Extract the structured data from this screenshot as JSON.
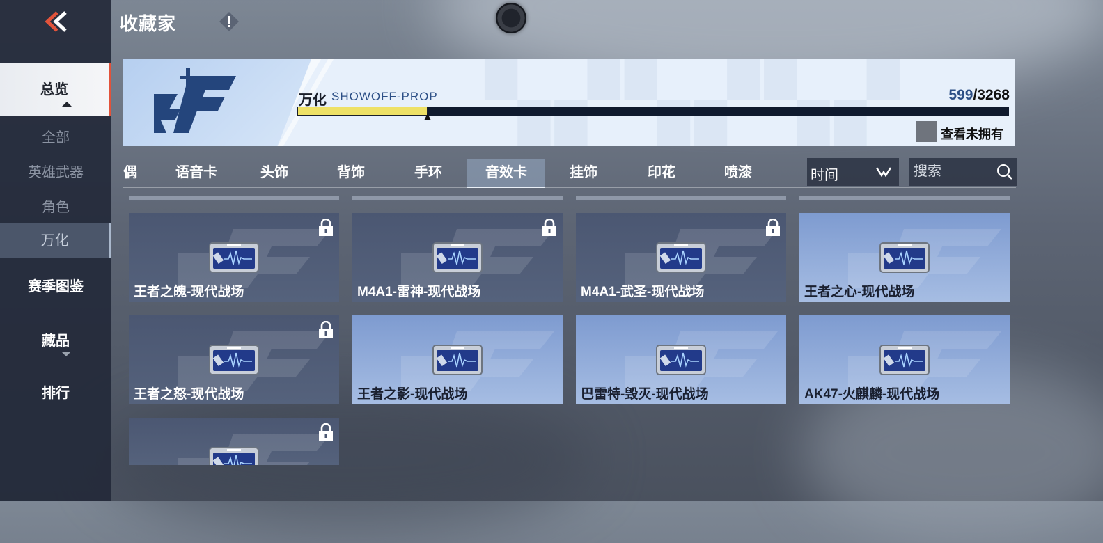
{
  "header": {
    "title": "收藏家"
  },
  "sidebar": {
    "active": "总览",
    "sub_items": [
      "全部",
      "英雄武器",
      "角色",
      "万化"
    ],
    "main_items": [
      "赛季图鉴",
      "藏品",
      "排行"
    ]
  },
  "banner": {
    "collection_name": "万化",
    "collection_tag": "SHOWOFF-PROP",
    "owned": "599",
    "total": "/3268",
    "progress": 0.183,
    "toggle_label": "查看未拥有"
  },
  "tabs": [
    "偶",
    "语音卡",
    "头饰",
    "背饰",
    "手环",
    "音效卡",
    "挂饰",
    "印花",
    "喷漆"
  ],
  "active_tab": "音效卡",
  "sort": {
    "label": "时间"
  },
  "search": {
    "placeholder": "搜索"
  },
  "items": [
    {
      "name": "王者之魄-现代战场",
      "locked": true
    },
    {
      "name": "M4A1-雷神-现代战场",
      "locked": true
    },
    {
      "name": "M4A1-武圣-现代战场",
      "locked": true
    },
    {
      "name": "王者之心-现代战场",
      "locked": false
    },
    {
      "name": "王者之怒-现代战场",
      "locked": true
    },
    {
      "name": "王者之影-现代战场",
      "locked": false
    },
    {
      "name": "巴雷特-毁灭-现代战场",
      "locked": false
    },
    {
      "name": "AK47-火麒麟-现代战场",
      "locked": false
    },
    {
      "name": "",
      "locked": true
    }
  ],
  "colors": {
    "accent": "#e2533b",
    "progress": "#eee166",
    "owned_count": "#2c4f86"
  }
}
